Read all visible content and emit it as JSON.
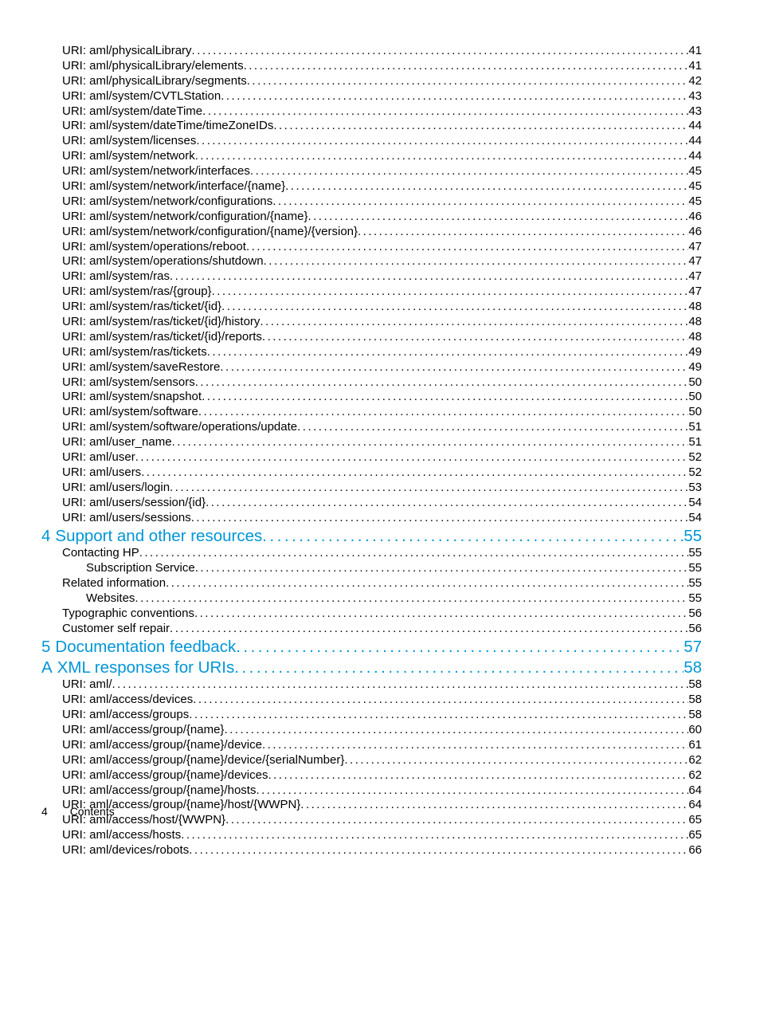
{
  "footer": {
    "page_number": "4",
    "label": "Contents"
  },
  "toc": [
    {
      "indent": 1,
      "type": "sub",
      "label": "URI: aml/physicalLibrary",
      "page": "41"
    },
    {
      "indent": 1,
      "type": "sub",
      "label": "URI: aml/physicalLibrary/elements",
      "page": "41"
    },
    {
      "indent": 1,
      "type": "sub",
      "label": "URI: aml/physicalLibrary/segments",
      "page": "42"
    },
    {
      "indent": 1,
      "type": "sub",
      "label": "URI: aml/system/CVTLStation",
      "page": "43"
    },
    {
      "indent": 1,
      "type": "sub",
      "label": "URI: aml/system/dateTime",
      "page": "43"
    },
    {
      "indent": 1,
      "type": "sub",
      "label": "URI: aml/system/dateTime/timeZoneIDs",
      "page": "44"
    },
    {
      "indent": 1,
      "type": "sub",
      "label": "URI: aml/system/licenses",
      "page": "44"
    },
    {
      "indent": 1,
      "type": "sub",
      "label": "URI: aml/system/network",
      "page": "44"
    },
    {
      "indent": 1,
      "type": "sub",
      "label": "URI: aml/system/network/interfaces",
      "page": "45"
    },
    {
      "indent": 1,
      "type": "sub",
      "label": "URI: aml/system/network/interface/{name}",
      "page": "45"
    },
    {
      "indent": 1,
      "type": "sub",
      "label": "URI: aml/system/network/configurations",
      "page": "45"
    },
    {
      "indent": 1,
      "type": "sub",
      "label": "URI: aml/system/network/configuration/{name}",
      "page": "46"
    },
    {
      "indent": 1,
      "type": "sub",
      "label": "URI: aml/system/network/configuration/{name}/{version}",
      "page": "46"
    },
    {
      "indent": 1,
      "type": "sub",
      "label": "URI: aml/system/operations/reboot",
      "page": "47"
    },
    {
      "indent": 1,
      "type": "sub",
      "label": "URI: aml/system/operations/shutdown",
      "page": "47"
    },
    {
      "indent": 1,
      "type": "sub",
      "label": "URI: aml/system/ras",
      "page": "47"
    },
    {
      "indent": 1,
      "type": "sub",
      "label": "URI: aml/system/ras/{group}",
      "page": "47"
    },
    {
      "indent": 1,
      "type": "sub",
      "label": "URI: aml/system/ras/ticket/{id}",
      "page": "48"
    },
    {
      "indent": 1,
      "type": "sub",
      "label": "URI: aml/system/ras/ticket/{id}/history",
      "page": "48"
    },
    {
      "indent": 1,
      "type": "sub",
      "label": "URI: aml/system/ras/ticket/{id}/reports",
      "page": "48"
    },
    {
      "indent": 1,
      "type": "sub",
      "label": "URI: aml/system/ras/tickets",
      "page": "49"
    },
    {
      "indent": 1,
      "type": "sub",
      "label": "URI: aml/system/saveRestore",
      "page": "49"
    },
    {
      "indent": 1,
      "type": "sub",
      "label": "URI: aml/system/sensors",
      "page": "50"
    },
    {
      "indent": 1,
      "type": "sub",
      "label": "URI: aml/system/snapshot",
      "page": "50"
    },
    {
      "indent": 1,
      "type": "sub",
      "label": "URI: aml/system/software",
      "page": "50"
    },
    {
      "indent": 1,
      "type": "sub",
      "label": "URI: aml/system/software/operations/update",
      "page": "51"
    },
    {
      "indent": 1,
      "type": "sub",
      "label": "URI: aml/user_name",
      "page": "51"
    },
    {
      "indent": 1,
      "type": "sub",
      "label": "URI: aml/user",
      "page": "52"
    },
    {
      "indent": 1,
      "type": "sub",
      "label": "URI: aml/users",
      "page": "52"
    },
    {
      "indent": 1,
      "type": "sub",
      "label": "URI: aml/users/login",
      "page": "53"
    },
    {
      "indent": 1,
      "type": "sub",
      "label": "URI: aml/users/session/{id}",
      "page": "54"
    },
    {
      "indent": 1,
      "type": "sub",
      "label": "URI: aml/users/sessions",
      "page": "54"
    },
    {
      "indent": 0,
      "type": "chapter",
      "num": "4",
      "label": "Support and other resources",
      "page": "55"
    },
    {
      "indent": 1,
      "type": "sub",
      "label": "Contacting HP",
      "page": "55"
    },
    {
      "indent": 2,
      "type": "sub",
      "label": "Subscription Service",
      "page": "55"
    },
    {
      "indent": 1,
      "type": "sub",
      "label": "Related information",
      "page": "55"
    },
    {
      "indent": 2,
      "type": "sub",
      "label": "Websites",
      "page": "55"
    },
    {
      "indent": 1,
      "type": "sub",
      "label": "Typographic conventions",
      "page": "56"
    },
    {
      "indent": 1,
      "type": "sub",
      "label": "Customer self repair",
      "page": "56"
    },
    {
      "indent": 0,
      "type": "chapter",
      "num": "5",
      "label": "Documentation feedback",
      "page": "57"
    },
    {
      "indent": 0,
      "type": "chapter",
      "num": "A",
      "label": "XML responses for URIs",
      "page": "58"
    },
    {
      "indent": 1,
      "type": "sub",
      "label": "URI: aml/",
      "page": "58"
    },
    {
      "indent": 1,
      "type": "sub",
      "label": "URI: aml/access/devices",
      "page": "58"
    },
    {
      "indent": 1,
      "type": "sub",
      "label": "URI: aml/access/groups",
      "page": "58"
    },
    {
      "indent": 1,
      "type": "sub",
      "label": "URI: aml/access/group/{name}",
      "page": "60"
    },
    {
      "indent": 1,
      "type": "sub",
      "label": "URI: aml/access/group/{name}/device",
      "page": "61"
    },
    {
      "indent": 1,
      "type": "sub",
      "label": "URI: aml/access/group/{name}/device/{serialNumber}",
      "page": "62"
    },
    {
      "indent": 1,
      "type": "sub",
      "label": "URI: aml/access/group/{name}/devices",
      "page": "62"
    },
    {
      "indent": 1,
      "type": "sub",
      "label": "URI: aml/access/group/{name}/hosts",
      "page": "64"
    },
    {
      "indent": 1,
      "type": "sub",
      "label": "URI: aml/access/group/{name}/host/{WWPN}",
      "page": "64"
    },
    {
      "indent": 1,
      "type": "sub",
      "label": "URI: aml/access/host/{WWPN}",
      "page": "65"
    },
    {
      "indent": 1,
      "type": "sub",
      "label": "URI: aml/access/hosts",
      "page": "65"
    },
    {
      "indent": 1,
      "type": "sub",
      "label": "URI: aml/devices/robots",
      "page": "66"
    }
  ]
}
